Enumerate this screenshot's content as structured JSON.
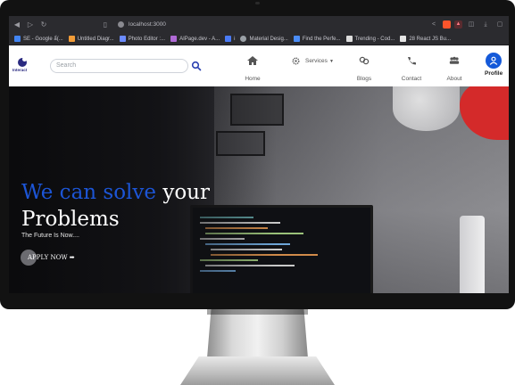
{
  "browser": {
    "url": "localhost:3000",
    "bookmarks": [
      {
        "label": "SE - Google ẩ(...",
        "color": "#4285f4"
      },
      {
        "label": "Untitled Diagr...",
        "color": "#f29c38"
      },
      {
        "label": "Photo Editor :...",
        "color": "#6b8bff"
      },
      {
        "label": "AIPage.dev - A...",
        "color": "#b06ad6"
      },
      {
        "label": "i",
        "color": "#4a7bf7"
      },
      {
        "label": "Material Desig...",
        "color": "#9aa0a6"
      },
      {
        "label": "Find the Perfe...",
        "color": "#4b8df8"
      },
      {
        "label": "Trending - Cod...",
        "color": "#dddddd"
      },
      {
        "label": "28 React JS Bu...",
        "color": "#e5e5e5"
      }
    ]
  },
  "site": {
    "logo_text": "Interact",
    "search_placeholder": "Search",
    "nav": {
      "home": "Home",
      "services": "Services",
      "blogs": "Blogs",
      "contact": "Contact",
      "about": "About",
      "profile": "Profile"
    },
    "hero": {
      "headline_blue": "We can solve",
      "headline_white": " your",
      "headline_line2": "Problems",
      "tagline": "The Future Is Now....",
      "cta": "APPLY NOW ➡"
    },
    "accent_color": "#1c55d6"
  }
}
